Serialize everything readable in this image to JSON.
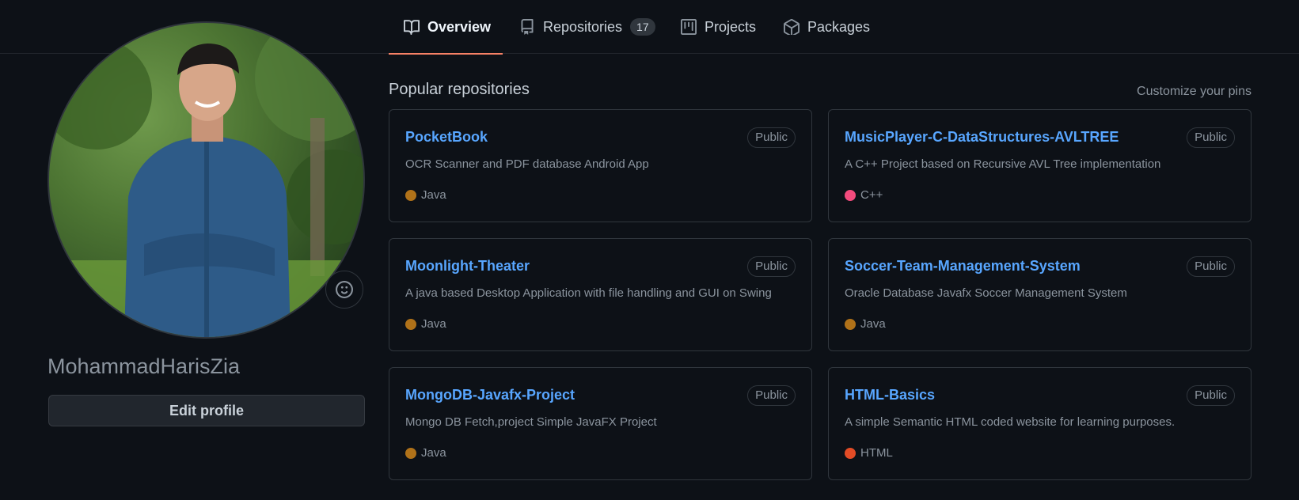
{
  "nav": {
    "tabs": [
      {
        "label": "Overview",
        "icon": "book-icon",
        "active": true
      },
      {
        "label": "Repositories",
        "icon": "repo-icon",
        "count": "17"
      },
      {
        "label": "Projects",
        "icon": "project-icon"
      },
      {
        "label": "Packages",
        "icon": "package-icon"
      }
    ]
  },
  "profile": {
    "username": "MohammadHarisZia",
    "edit_label": "Edit profile",
    "avatar_desc": "profile photo",
    "status_icon": "smiley-icon"
  },
  "main": {
    "section_title": "Popular repositories",
    "customize_label": "Customize your pins",
    "repos": [
      {
        "name": "PocketBook",
        "visibility": "Public",
        "description": "OCR Scanner and PDF database Android App",
        "language": "Java",
        "lang_color": "#b07219"
      },
      {
        "name": "MusicPlayer-C-DataStructures-AVLTREE",
        "visibility": "Public",
        "description": "A C++ Project based on Recursive AVL Tree implementation",
        "language": "C++",
        "lang_color": "#f34b7d"
      },
      {
        "name": "Moonlight-Theater",
        "visibility": "Public",
        "description": "A java based Desktop Application with file handling and GUI on Swing",
        "language": "Java",
        "lang_color": "#b07219"
      },
      {
        "name": "Soccer-Team-Management-System",
        "visibility": "Public",
        "description": "Oracle Database Javafx Soccer Management System",
        "language": "Java",
        "lang_color": "#b07219"
      },
      {
        "name": "MongoDB-Javafx-Project",
        "visibility": "Public",
        "description": "Mongo DB Fetch,project Simple JavaFX Project",
        "language": "Java",
        "lang_color": "#b07219"
      },
      {
        "name": "HTML-Basics",
        "visibility": "Public",
        "description": "A simple Semantic HTML coded website for learning purposes.",
        "language": "HTML",
        "lang_color": "#e34c26"
      }
    ]
  },
  "colors": {
    "background": "#0d1117",
    "link": "#58a6ff",
    "active_tab_underline": "#f78166"
  }
}
